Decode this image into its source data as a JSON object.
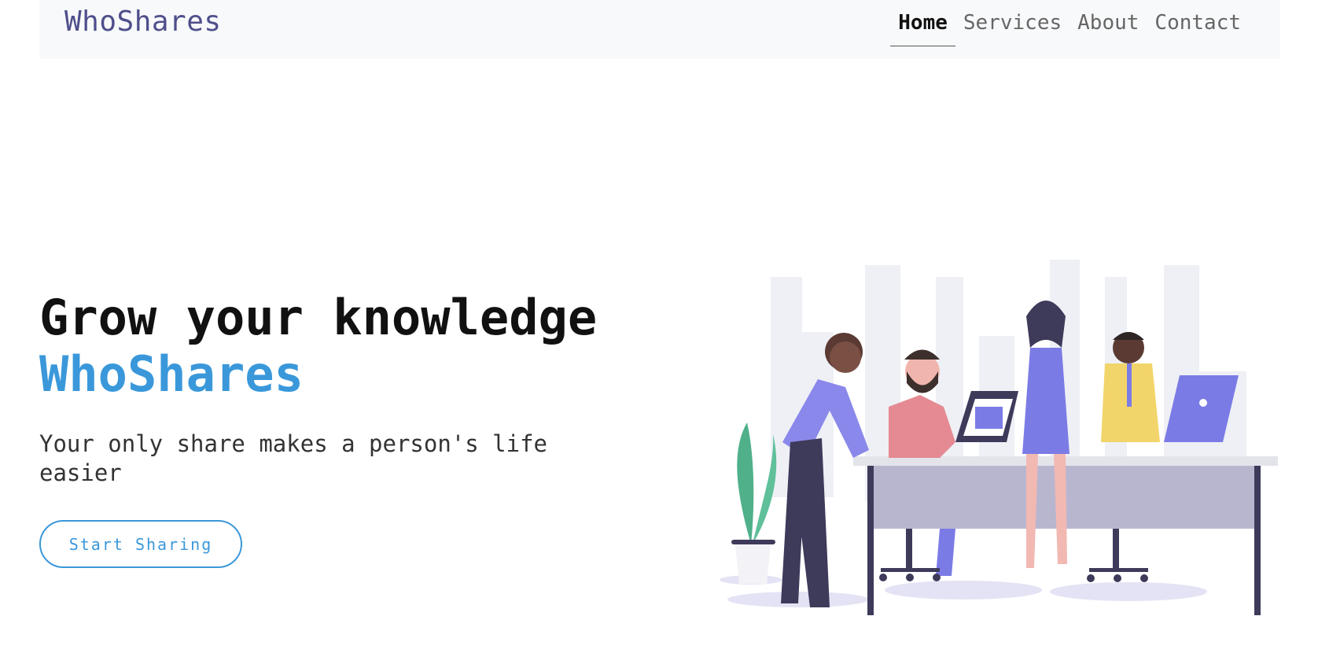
{
  "navbar": {
    "brand": "WhoShares",
    "links": [
      {
        "label": "Home",
        "active": true
      },
      {
        "label": "Services",
        "active": false
      },
      {
        "label": "About",
        "active": false
      },
      {
        "label": "Contact",
        "active": false
      }
    ]
  },
  "hero": {
    "title": "Grow your knowledge",
    "brand": "WhoShares",
    "subtitle": "Your only share makes a person's life easier",
    "cta_label": "Start Sharing"
  },
  "colors": {
    "accent": "#3a98da",
    "brand_nav": "#4f4f8c",
    "navbar_bg": "#f8f9fa",
    "illustration_purple": "#7b7be6"
  },
  "illustration": {
    "icon": "team-meeting-illustration"
  }
}
